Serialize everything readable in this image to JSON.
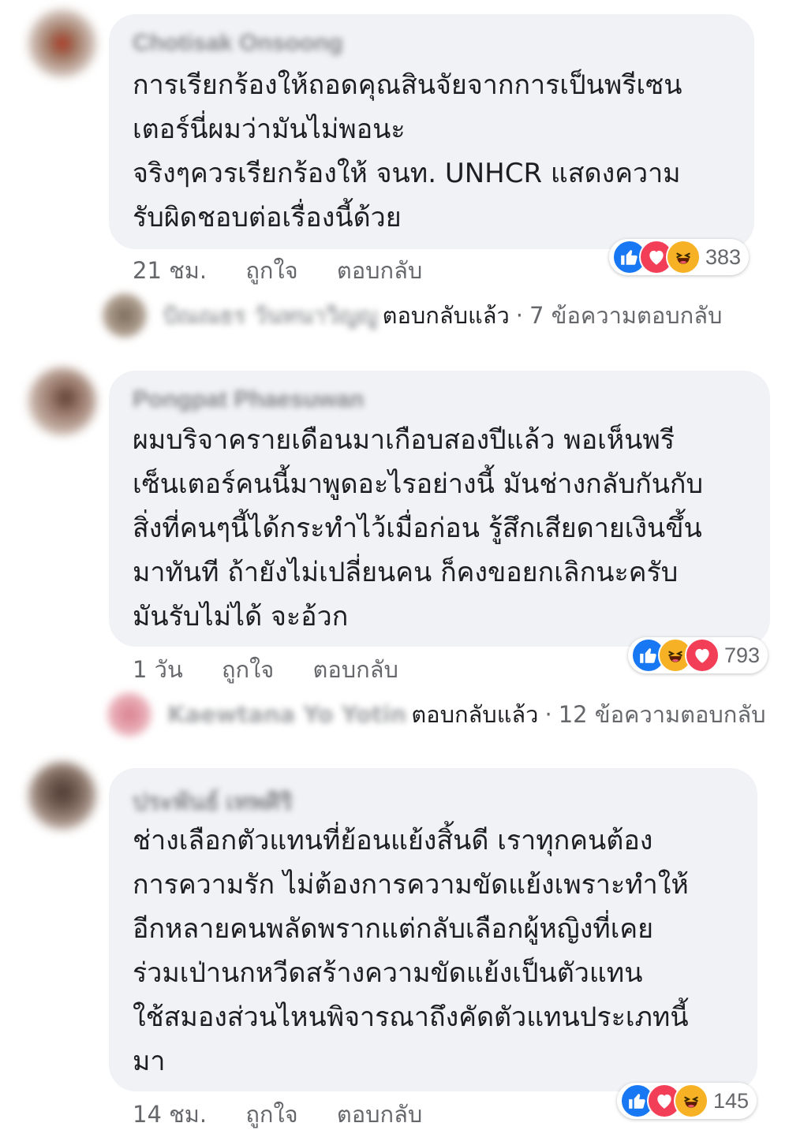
{
  "comments": [
    {
      "author": "Chotisak Onsoong",
      "text": "การเรียกร้องให้ถอดคุณสินจัยจากการเป็นพรีเซน\nเตอร์นี่ผมว่ามันไม่พอนะ\nจริงๆควรเรียกร้องให้ จนท. UNHCR แสดงความ\nรับผิดชอบต่อเรื่องนี้ด้วย",
      "time": "21 ชม.",
      "like_label": "ถูกใจ",
      "reply_label": "ตอบกลับ",
      "reactions": [
        "like",
        "love",
        "haha"
      ],
      "reaction_count": "383",
      "reply_thread": {
        "author": "ปัณณธร วันทนาวิญญู",
        "label": "ตอบกลับแล้ว",
        "separator": "·",
        "count": "7 ข้อความตอบกลับ"
      }
    },
    {
      "author": "Pongpat Phaesuwan",
      "text": "ผมบริจาครายเดือนมาเกือบสองปีแล้ว พอเห็นพรี\nเซ็นเตอร์คนนี้มาพูดอะไรอย่างนี้ มันช่างกลับกันกับ\nสิ่งที่คนๆนี้ได้กระทำไว้เมื่อก่อน รู้สึกเสียดายเงินขึ้น\nมาทันที ถ้ายังไม่เปลี่ยนคน ก็คงขอยกเลิกนะครับ\nมันรับไม่ได้ จะอ้วก",
      "time": "1 วัน",
      "like_label": "ถูกใจ",
      "reply_label": "ตอบกลับ",
      "reactions": [
        "like",
        "haha",
        "love"
      ],
      "reaction_count": "793",
      "reply_thread": {
        "author": "Kaewtana Yo Yotin",
        "label": "ตอบกลับแล้ว",
        "separator": "·",
        "count": "12 ข้อความตอบกลับ"
      }
    },
    {
      "author": "ประพันธ์ เทพศิริ",
      "text": "ช่างเลือกตัวแทนที่ย้อนแย้งสิ้นดี  เราทุกคนต้อง\nการความรัก ไม่ต้องการความขัดแย้งเพราะทำให้\nอีกหลายคนพลัดพรากแต่กลับเลือกผู้หญิงที่เคย\nร่วมเป่านกหวีดสร้างความขัดแย้งเป็นตัวแทน\nใช้สมองส่วนไหนพิจารณาถึงคัดตัวแทนประเภทนี้\nมา",
      "time": "14 ชม.",
      "like_label": "ถูกใจ",
      "reply_label": "ตอบกลับ",
      "reactions": [
        "like",
        "love",
        "haha"
      ],
      "reaction_count": "145"
    }
  ],
  "icons": {
    "like": "thumbs-up-icon",
    "love": "heart-icon",
    "haha": "laughing-face-icon"
  },
  "colors": {
    "bubble": "#f0f2f5",
    "meta_text": "#65676b",
    "like_blue": "#1877f2",
    "love_red": "#f33e58",
    "haha_yellow": "#f7b125"
  }
}
